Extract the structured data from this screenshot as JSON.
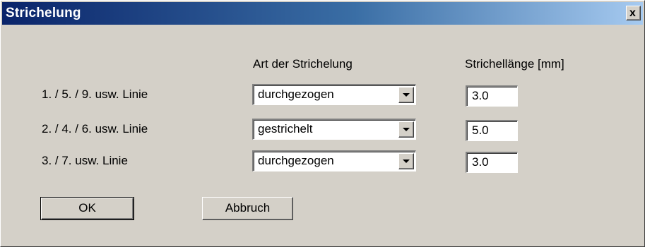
{
  "dialog": {
    "title": "Strichelung",
    "close_label": "x"
  },
  "headers": {
    "style": "Art der Strichelung",
    "length": "Strichellänge [mm]"
  },
  "rows": [
    {
      "label": "1. / 5. / 9. usw. Linie",
      "style": "durchgezogen",
      "length": "3.0"
    },
    {
      "label": "2. / 4. / 6. usw. Linie",
      "style": "gestrichelt",
      "length": "5.0"
    },
    {
      "label": "3. / 7. usw. Linie",
      "style": "durchgezogen",
      "length": "3.0"
    }
  ],
  "buttons": {
    "ok": "OK",
    "cancel": "Abbruch"
  }
}
